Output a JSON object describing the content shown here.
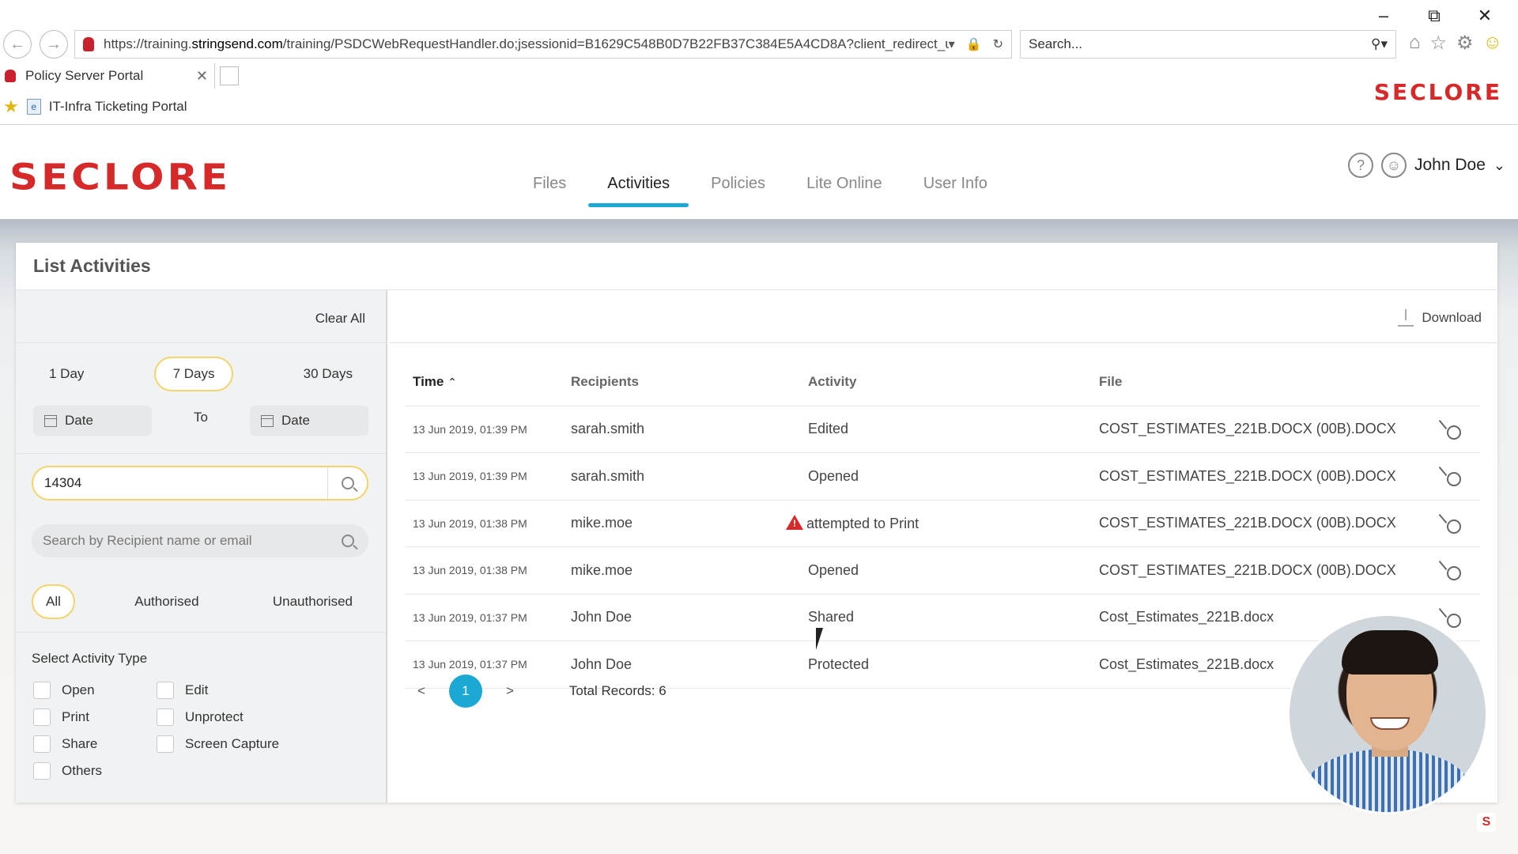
{
  "browser": {
    "url_prefix": "https://training.",
    "url_domain": "stringsend.com",
    "url_rest": "/training/PSDCWebRequestHandler.do;jsessionid=B1629C548B0D7B22FB37C384E5A4CD8A?client_redirect_url=%",
    "search_placeholder": "Search...",
    "tab_title": "Policy Server Portal",
    "favorite": "IT-Infra Ticketing Portal",
    "brand": "SECLORE"
  },
  "app": {
    "logo": "SECLORE",
    "nav": [
      {
        "label": "Files"
      },
      {
        "label": "Activities"
      },
      {
        "label": "Policies"
      },
      {
        "label": "Lite Online"
      },
      {
        "label": "User Info"
      }
    ],
    "user_name": "John Doe"
  },
  "panel": {
    "title": "List Activities",
    "clear_all": "Clear All",
    "ranges": [
      "1 Day",
      "7 Days",
      "30 Days"
    ],
    "date_from": "Date",
    "date_to_label": "To",
    "date_to": "Date",
    "id_value": "14304",
    "recipient_placeholder": "Search by Recipient name or email",
    "auth_filters": [
      "All",
      "Authorised",
      "Unauthorised"
    ],
    "activity_type_title": "Select Activity Type",
    "activity_types": [
      "Open",
      "Edit",
      "Print",
      "Unprotect",
      "Share",
      "Screen Capture",
      "Others"
    ],
    "download": "Download"
  },
  "table": {
    "headers": [
      "Time",
      "Recipients",
      "Activity",
      "File"
    ],
    "rows": [
      {
        "time": "13 Jun 2019, 01:39 PM",
        "recipient": "sarah.smith",
        "activity": "Edited",
        "file": "COST_ESTIMATES_221B.DOCX (00B).DOCX"
      },
      {
        "time": "13 Jun 2019, 01:39 PM",
        "recipient": "sarah.smith",
        "activity": "Opened",
        "file": "COST_ESTIMATES_221B.DOCX (00B).DOCX"
      },
      {
        "time": "13 Jun 2019, 01:38 PM",
        "recipient": "mike.moe",
        "activity": "attempted to Print",
        "file": "COST_ESTIMATES_221B.DOCX (00B).DOCX"
      },
      {
        "time": "13 Jun 2019, 01:38 PM",
        "recipient": "mike.moe",
        "activity": "Opened",
        "file": "COST_ESTIMATES_221B.DOCX (00B).DOCX"
      },
      {
        "time": "13 Jun 2019, 01:37 PM",
        "recipient": "John Doe",
        "activity": "Shared",
        "file": "Cost_Estimates_221B.docx"
      },
      {
        "time": "13 Jun 2019, 01:37 PM",
        "recipient": "John Doe",
        "activity": "Protected",
        "file": "Cost_Estimates_221B.docx"
      }
    ],
    "page": "1",
    "prev": "<",
    "next": ">",
    "total": "Total Records: 6"
  },
  "colors": {
    "brand": "#d62a2a",
    "accent": "#1ba8d4",
    "highlight": "#f3d46b"
  }
}
